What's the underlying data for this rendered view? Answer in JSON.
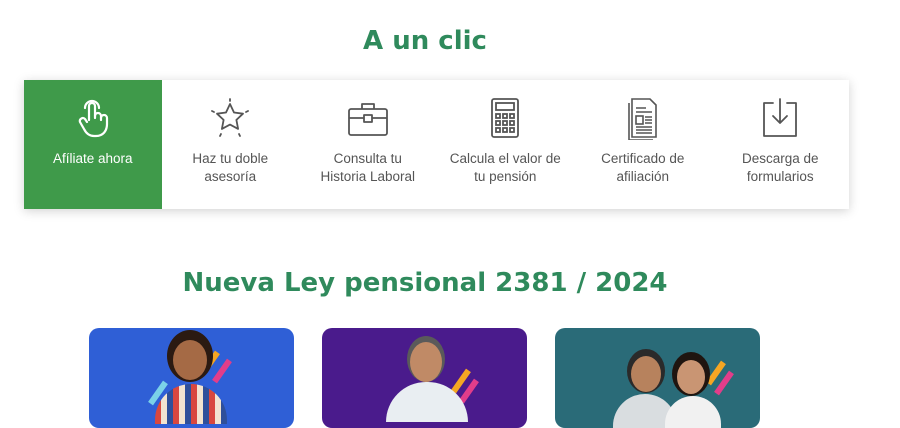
{
  "sections": {
    "quick_access_title": "A un clic",
    "law_title": "Nueva Ley pensional 2381 / 2024"
  },
  "quick_access": {
    "items": [
      {
        "label": "Afíliate ahora",
        "icon": "hand-pointer-icon"
      },
      {
        "label": "Haz tu doble\nasesoría",
        "icon": "star-icon"
      },
      {
        "label": "Consulta tu\nHistoria Laboral",
        "icon": "briefcase-icon"
      },
      {
        "label": "Calcula el valor de\ntu pensión",
        "icon": "calculator-icon"
      },
      {
        "label": "Certificado de\nafiliación",
        "icon": "document-icon"
      },
      {
        "label": "Descarga de\nformularios",
        "icon": "download-icon"
      }
    ]
  },
  "colors": {
    "accent_green": "#3f9a4a",
    "title_green": "#2f8a5c",
    "card_blue": "#2f5fd6",
    "card_purple": "#4a1b8c",
    "card_teal": "#2a6b78"
  }
}
